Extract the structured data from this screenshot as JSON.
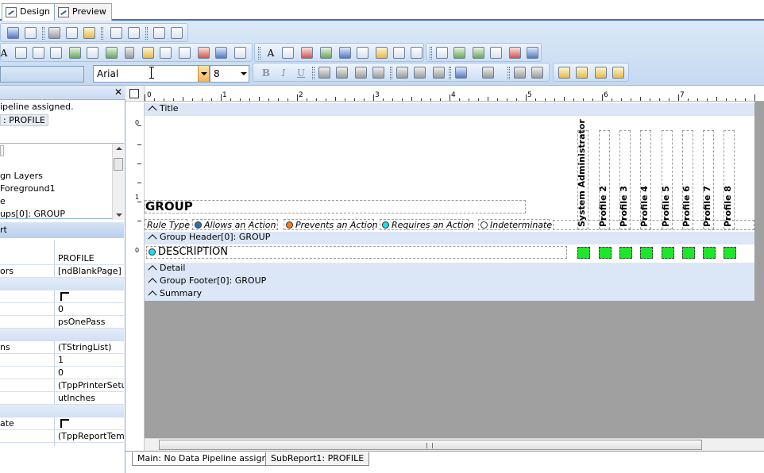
{
  "view_tabs": {
    "design": "Design",
    "preview": "Preview"
  },
  "font_toolbar": {
    "font_name": "Arial",
    "font_size": "8",
    "bold": "B",
    "italic": "I",
    "underline": "U"
  },
  "left_panel": {
    "close_glyph": "✕",
    "pipeline_text": "ipeline assigned.",
    "profile_chip": ": PROFILE",
    "tree": [
      "gn Layers",
      "Foreground1",
      "e",
      "ups[0]: GROUP"
    ],
    "inspector_header": "rt",
    "properties": [
      {
        "name": "",
        "value": "PROFILE"
      },
      {
        "name": "ors",
        "value": "[ndBlankPage]"
      },
      {
        "name": "",
        "value": "0"
      },
      {
        "name": "",
        "value": "psOnePass"
      },
      {
        "name": "ns",
        "value": "(TStringList)"
      },
      {
        "name": "",
        "value": "1"
      },
      {
        "name": "",
        "value": "0"
      },
      {
        "name": "",
        "value": "(TppPrinterSetup)"
      },
      {
        "name": "",
        "value": "utInches"
      },
      {
        "name": "ate",
        "value": ""
      },
      {
        "name": "",
        "value": "(TppReportTempl"
      }
    ]
  },
  "ruler": {
    "h_labels": [
      "0",
      "1",
      "2",
      "3",
      "4",
      "5",
      "6",
      "7"
    ],
    "v_labels": [
      "0",
      "1",
      "0"
    ]
  },
  "report": {
    "bands": {
      "title": "Title",
      "group_header": "Group Header[0]: GROUP",
      "detail": "Detail",
      "group_footer": "Group Footer[0]: GROUP",
      "summary": "Summary"
    },
    "group_label": "GROUP",
    "rule_type": "Rule Type",
    "legend": [
      {
        "text": "Allows an Action",
        "color": "#2f6fb0"
      },
      {
        "text": "Prevents an Action",
        "color": "#ff7a1a"
      },
      {
        "text": "Requires an Action",
        "color": "#18e0e8"
      },
      {
        "text": "Indeterminate",
        "color": "#ffffff"
      }
    ],
    "columns": [
      "System Administrator",
      "Profile 2",
      "Profile 3",
      "Profile 4",
      "Profile 5",
      "Profile 6",
      "Profile 7",
      "Profile 8"
    ],
    "description": "DESCRIPTION",
    "description_dot_color": "#18e0e8",
    "cell_color": "#1ee62a"
  },
  "bottom_tabs": {
    "main": "Main: No Data Pipeline assigned.",
    "sub": "SubReport1: PROFILE"
  }
}
